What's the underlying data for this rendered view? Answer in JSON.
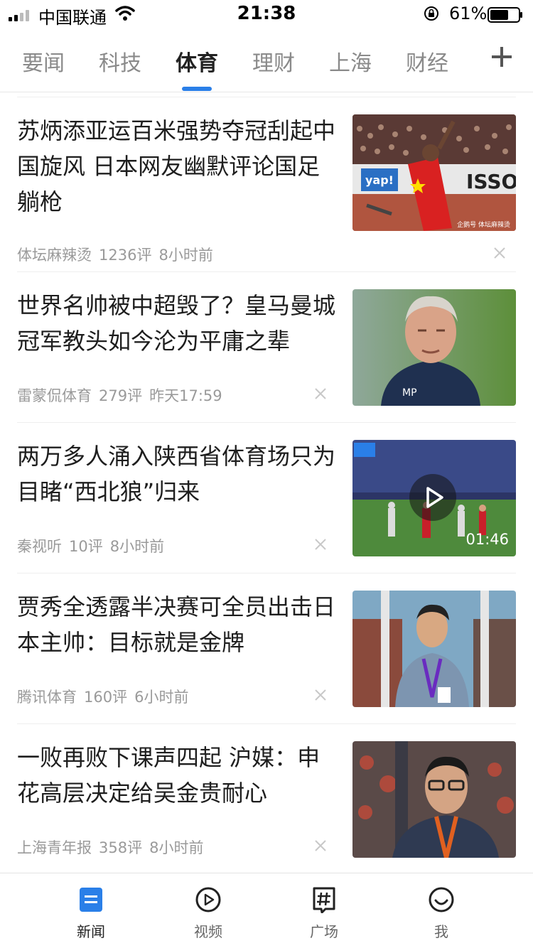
{
  "status_bar": {
    "carrier": "中国联通",
    "time": "21:38",
    "battery": "61%"
  },
  "tabs": [
    {
      "label": "要闻"
    },
    {
      "label": "科技"
    },
    {
      "label": "体育",
      "active": true
    },
    {
      "label": "理财"
    },
    {
      "label": "上海"
    },
    {
      "label": "财经"
    }
  ],
  "accent_color": "#2a7fe8",
  "feed": [
    {
      "title": "苏炳添亚运百米强势夺冠刮起中国旋风 日本网友幽默评论国足躺枪",
      "source": "体坛麻辣烫",
      "comments": "1236评",
      "time": "8小时前",
      "thumb_watermark": "企鹅号 体坛麻辣烫"
    },
    {
      "title": "世界名帅被中超毁了？皇马曼城冠军教头如今沦为平庸之辈",
      "source": "雷蒙侃体育",
      "comments": "279评",
      "time": "昨天17:59",
      "thumb_jacket_text": "MP"
    },
    {
      "title": "两万多人涌入陕西省体育场只为目睹“西北狼”归来",
      "source": "秦视听",
      "comments": "10评",
      "time": "8小时前",
      "video_duration": "01:46"
    },
    {
      "title": "贾秀全透露半决赛可全员出击日本主帅：目标就是金牌",
      "source": "腾讯体育",
      "comments": "160评",
      "time": "6小时前"
    },
    {
      "title": "一败再败下课声四起 沪媒：申花高层决定给吴金贵耐心",
      "source": "上海青年报",
      "comments": "358评",
      "time": "8小时前"
    }
  ],
  "bottom_nav": [
    {
      "label": "新闻",
      "icon": "news-icon",
      "active": true
    },
    {
      "label": "视频",
      "icon": "play-icon"
    },
    {
      "label": "广场",
      "icon": "hashtag-icon"
    },
    {
      "label": "我",
      "icon": "smile-icon"
    }
  ]
}
